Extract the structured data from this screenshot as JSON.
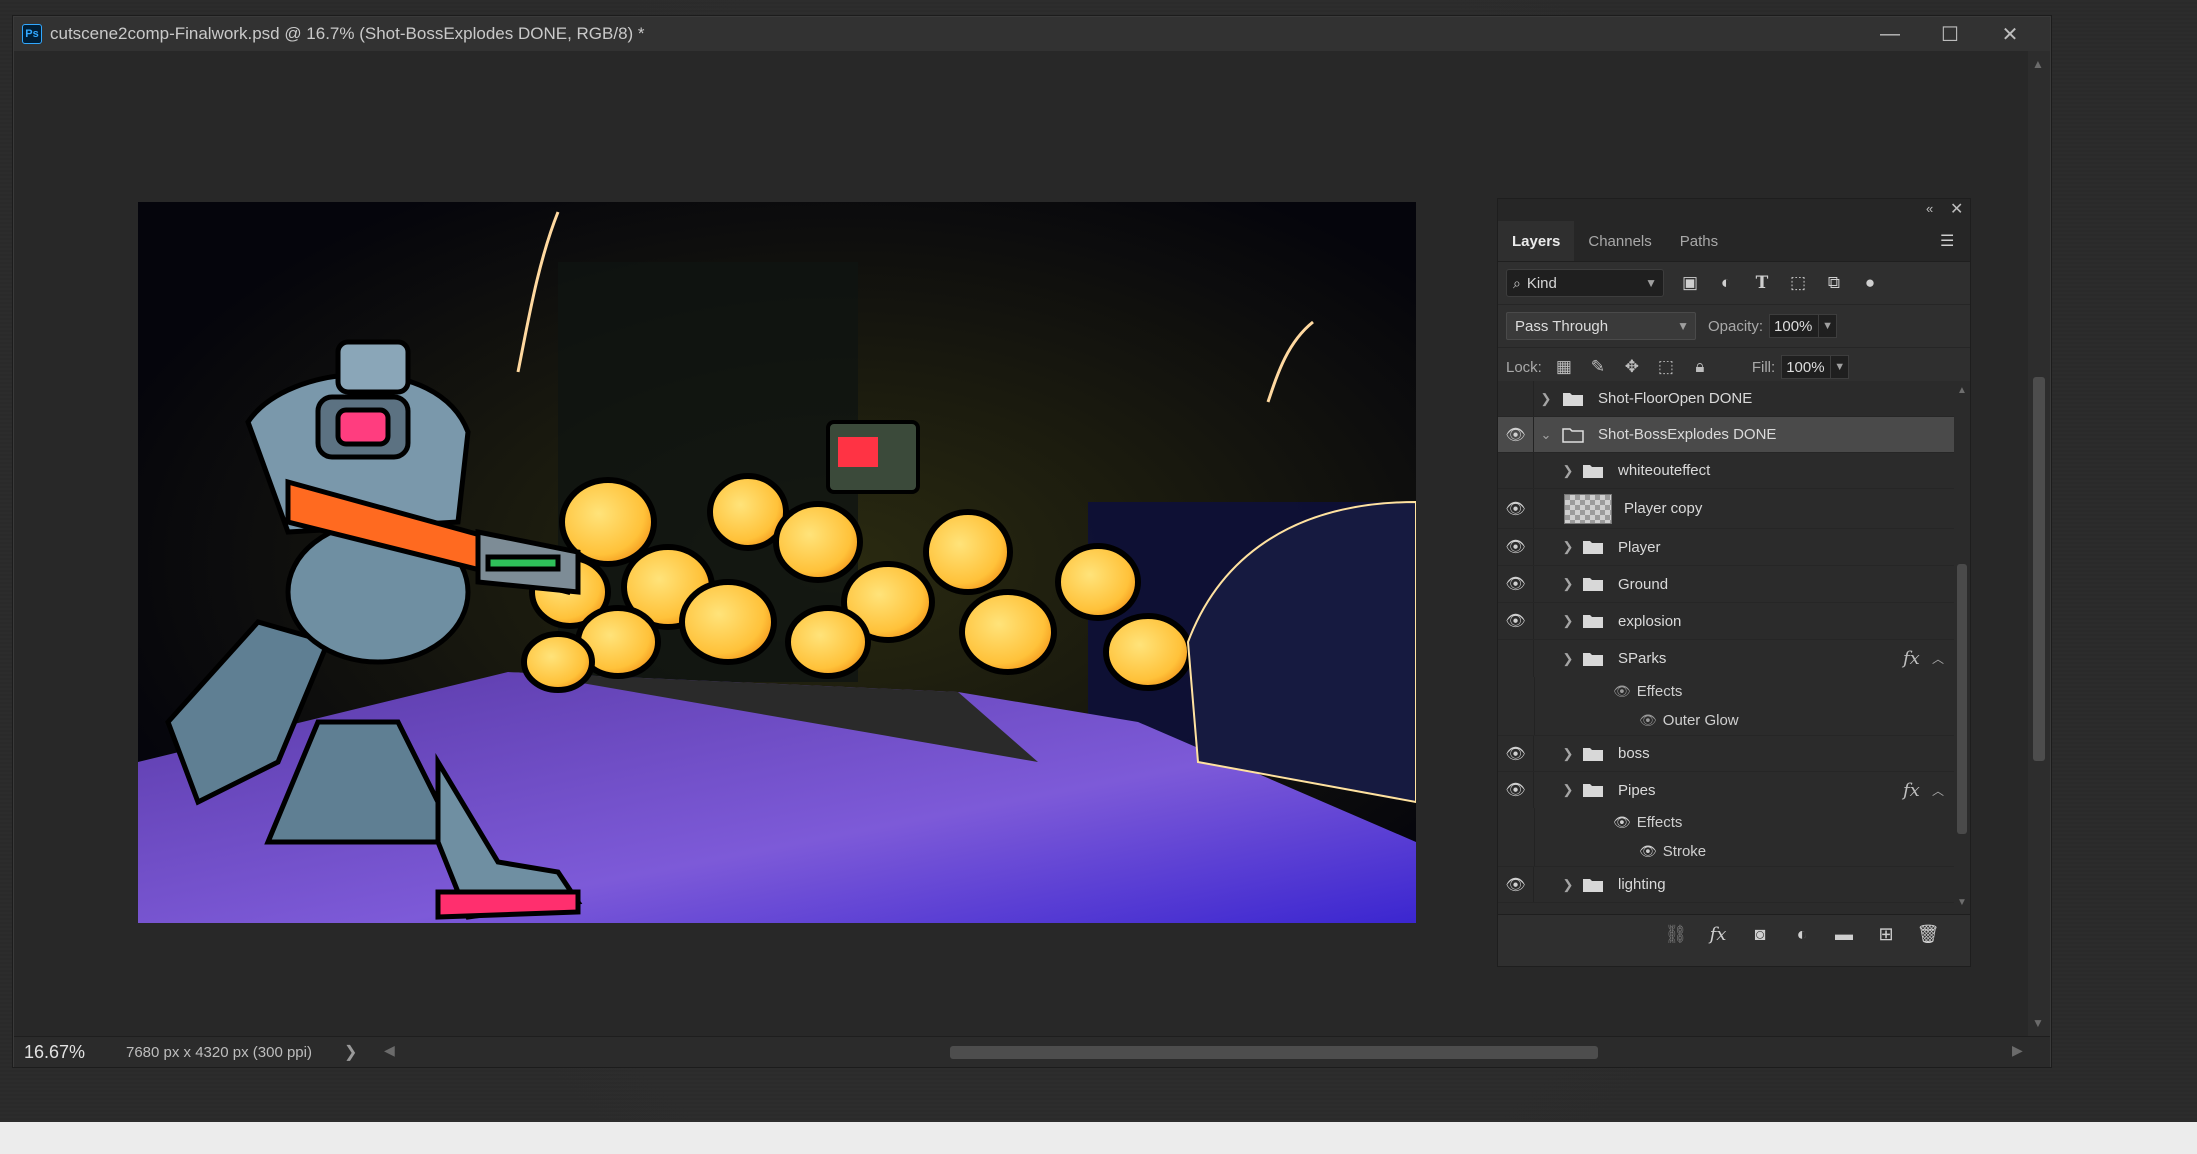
{
  "window": {
    "title": "cutscene2comp-Finalwork.psd @ 16.7% (Shot-BossExplodes DONE, RGB/8) *",
    "app_icon": "Ps",
    "controls": {
      "minimize": "—",
      "maximize": "☐",
      "close": "✕"
    }
  },
  "status": {
    "zoom": "16.67%",
    "doc_size": "7680 px x 4320 px (300 ppi)",
    "chevron": "❯"
  },
  "layers_panel": {
    "tabs": [
      {
        "label": "Layers",
        "active": true
      },
      {
        "label": "Channels",
        "active": false
      },
      {
        "label": "Paths",
        "active": false
      }
    ],
    "filter": {
      "label": "Kind"
    },
    "blend_mode": "Pass Through",
    "opacity_label": "Opacity:",
    "opacity_value": "100%",
    "lock_label": "Lock:",
    "fill_label": "Fill:",
    "fill_value": "100%",
    "layers": [
      {
        "name": "Shot-FloorOpen DONE",
        "visible": false,
        "type": "group",
        "indent": 0,
        "expanded": false,
        "selected": false
      },
      {
        "name": "Shot-BossExplodes DONE",
        "visible": true,
        "type": "group",
        "indent": 0,
        "expanded": true,
        "selected": true
      },
      {
        "name": "whiteouteffect",
        "visible": false,
        "type": "group",
        "indent": 1,
        "expanded": false,
        "selected": false
      },
      {
        "name": "Player copy",
        "visible": true,
        "type": "pixel",
        "indent": 1,
        "expanded": false,
        "selected": false
      },
      {
        "name": "Player",
        "visible": true,
        "type": "group",
        "indent": 1,
        "expanded": false,
        "selected": false
      },
      {
        "name": "Ground",
        "visible": true,
        "type": "group",
        "indent": 1,
        "expanded": false,
        "selected": false
      },
      {
        "name": "explosion",
        "visible": true,
        "type": "group",
        "indent": 1,
        "expanded": false,
        "selected": false
      },
      {
        "name": "SParks",
        "visible": false,
        "type": "group",
        "indent": 1,
        "expanded": false,
        "selected": false,
        "fx": true
      },
      {
        "name": "boss",
        "visible": true,
        "type": "group",
        "indent": 1,
        "expanded": false,
        "selected": false
      },
      {
        "name": "Pipes",
        "visible": true,
        "type": "group",
        "indent": 1,
        "expanded": false,
        "selected": false,
        "fx": true
      },
      {
        "name": "lighting",
        "visible": true,
        "type": "group",
        "indent": 1,
        "expanded": false,
        "selected": false
      }
    ],
    "sparks_effects": {
      "header": "Effects",
      "items": [
        "Outer Glow"
      ]
    },
    "pipes_effects": {
      "header": "Effects",
      "items": [
        "Stroke"
      ]
    },
    "fx_label": "fx"
  }
}
